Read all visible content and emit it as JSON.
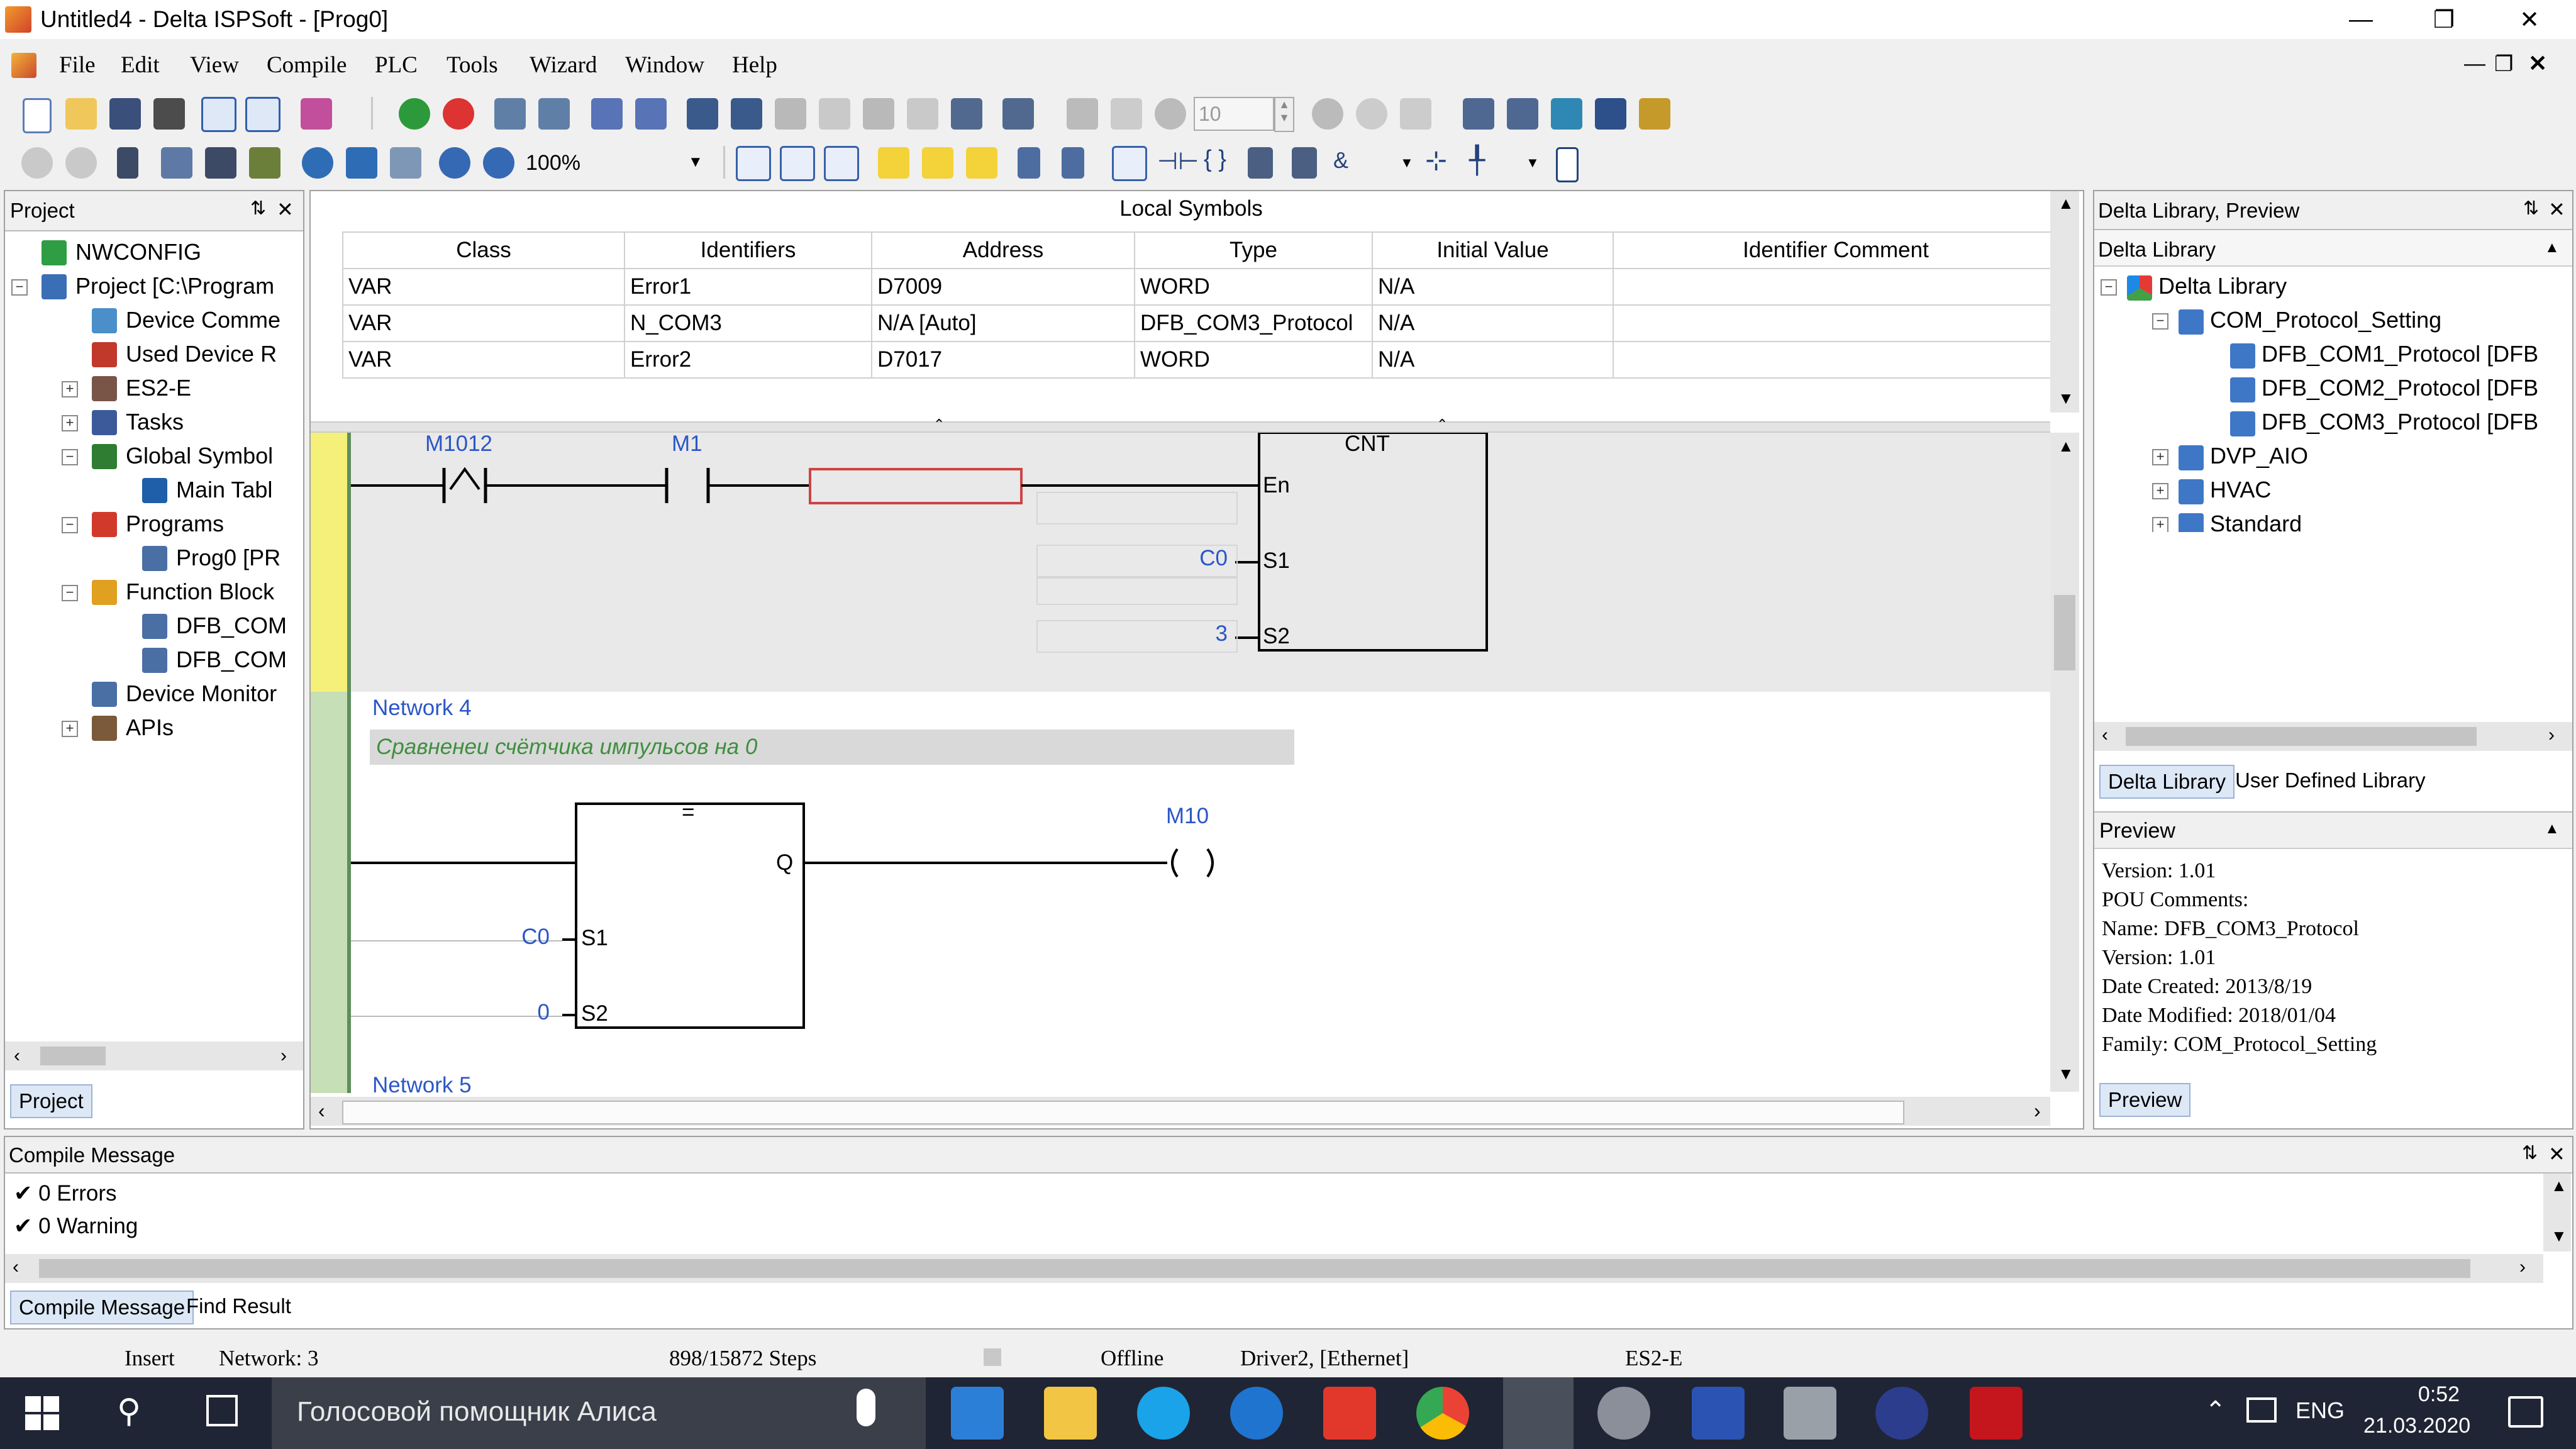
{
  "window": {
    "title": "Untitled4 - Delta ISPSoft - [Prog0]"
  },
  "menu": [
    "File",
    "Edit",
    "View",
    "Compile",
    "PLC",
    "Tools",
    "Wizard",
    "Window",
    "Help"
  ],
  "toolbar": {
    "zoom": "100%",
    "counter": "10"
  },
  "project_panel": {
    "title": "Project",
    "tab": "Project",
    "tree": [
      {
        "label": "NWCONFIG",
        "icon": "network-config-icon"
      },
      {
        "label": "Project [C:\\Program",
        "icon": "project-icon"
      },
      {
        "label": "Device Comme",
        "icon": "device-comment-icon"
      },
      {
        "label": "Used Device R",
        "icon": "used-device-icon"
      },
      {
        "label": "ES2-E",
        "icon": "plc-icon"
      },
      {
        "label": "Tasks",
        "icon": "tasks-icon"
      },
      {
        "label": "Global Symbol",
        "icon": "global-symbol-icon"
      },
      {
        "label": "Main Tabl",
        "icon": "table-icon"
      },
      {
        "label": "Programs",
        "icon": "programs-icon"
      },
      {
        "label": "Prog0 [PR",
        "icon": "program-icon"
      },
      {
        "label": "Function Block",
        "icon": "function-block-icon"
      },
      {
        "label": "DFB_COM",
        "icon": "dfb-icon"
      },
      {
        "label": "DFB_COM",
        "icon": "dfb-icon"
      },
      {
        "label": "Device Monitor",
        "icon": "monitor-icon"
      },
      {
        "label": "APIs",
        "icon": "apis-icon"
      }
    ]
  },
  "local_symbols": {
    "title": "Local Symbols",
    "columns": [
      "Class",
      "Identifiers",
      "Address",
      "Type",
      "Initial Value",
      "Identifier Comment"
    ],
    "rows": [
      [
        "VAR",
        "Error1",
        "D7009",
        "WORD",
        "N/A",
        ""
      ],
      [
        "VAR",
        "N_COM3",
        "N/A [Auto]",
        "DFB_COM3_Protocol",
        "N/A",
        ""
      ],
      [
        "VAR",
        "Error2",
        "D7017",
        "WORD",
        "N/A",
        ""
      ]
    ]
  },
  "ladder": {
    "net3": {
      "contact1": "M1012",
      "contact2": "M1",
      "block_name": "CNT",
      "pin_en": "En",
      "pin_s1": "S1",
      "pin_s2": "S2",
      "s1_value": "C0",
      "s2_value": "3"
    },
    "net4": {
      "label": "Network 4",
      "comment": "Сравненеи счётчика импульсов на 0",
      "block_name": "=",
      "pin_q": "Q",
      "pin_s1": "S1",
      "pin_s2": "S2",
      "s1_value": "C0",
      "s2_value": "0",
      "coil": "M10"
    },
    "net5_label": "Network 5"
  },
  "library": {
    "title": "Delta Library, Preview",
    "dropdown": "Delta Library",
    "tree": [
      {
        "label": "Delta Library"
      },
      {
        "label": "COM_Protocol_Setting"
      },
      {
        "label": "DFB_COM1_Protocol [DFB"
      },
      {
        "label": "DFB_COM2_Protocol [DFB"
      },
      {
        "label": "DFB_COM3_Protocol [DFB"
      },
      {
        "label": "DVP_AIO"
      },
      {
        "label": "HVAC"
      },
      {
        "label": "Standard"
      }
    ],
    "tabs": [
      "Delta Library",
      "User Defined Library"
    ],
    "preview_header": "Preview",
    "preview_lines": [
      "Version: 1.01",
      "POU Comments:",
      "Name: DFB_COM3_Protocol",
      "Version: 1.01",
      "Date Created:    2013/8/19",
      "Date Modified: 2018/01/04",
      "Family: COM_Protocol_Setting"
    ],
    "preview_tab": "Preview"
  },
  "compile": {
    "title": "Compile Message",
    "lines": [
      "0 Errors",
      "0 Warning"
    ],
    "tabs": [
      "Compile Message",
      "Find Result"
    ]
  },
  "statusbar": {
    "mode": "Insert",
    "network": "Network: 3",
    "steps": "898/15872 Steps",
    "state": "Offline",
    "driver": "Driver2, [Ethernet]",
    "model": "ES2-E"
  },
  "taskbar": {
    "search_text": "Голосовой помощник Алиса",
    "lang": "ENG",
    "time": "0:52",
    "date": "21.03.2020"
  },
  "colors": {
    "accent_blue": "#2b56c6",
    "ladder_bg": "#e9e9e9",
    "rail_yellow": "#f5f07a",
    "rail_green": "#c6dfb6",
    "taskbar": "#1f2534"
  }
}
